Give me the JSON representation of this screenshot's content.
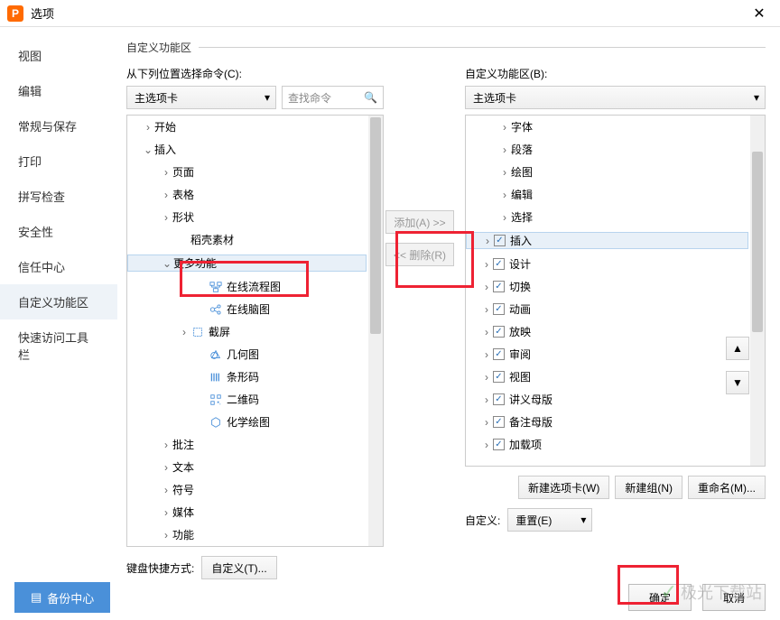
{
  "title": "选项",
  "sidebar": [
    "视图",
    "编辑",
    "常规与保存",
    "打印",
    "拼写检查",
    "安全性",
    "信任中心",
    "自定义功能区",
    "快速访问工具栏"
  ],
  "sidebar_active": 7,
  "section_title": "自定义功能区",
  "left": {
    "label": "从下列位置选择命令(C):",
    "select": "主选项卡",
    "search_placeholder": "查找命令",
    "tree": [
      {
        "d": 1,
        "exp": ">",
        "t": "开始"
      },
      {
        "d": 1,
        "exp": "v",
        "t": "插入"
      },
      {
        "d": 2,
        "exp": ">",
        "t": "页面"
      },
      {
        "d": 2,
        "exp": ">",
        "t": "表格"
      },
      {
        "d": 2,
        "exp": ">",
        "t": "形状"
      },
      {
        "d": 3,
        "exp": "",
        "t": "稻壳素材"
      },
      {
        "d": 2,
        "exp": "v",
        "t": "更多功能",
        "hi": true
      },
      {
        "d": 4,
        "exp": "",
        "icon": "flow",
        "t": "在线流程图"
      },
      {
        "d": 4,
        "exp": "",
        "icon": "mind",
        "t": "在线脑图"
      },
      {
        "d": 3,
        "exp": ">",
        "icon": "crop",
        "t": "截屏"
      },
      {
        "d": 4,
        "exp": "",
        "icon": "geo",
        "t": "几何图"
      },
      {
        "d": 4,
        "exp": "",
        "icon": "bar",
        "t": "条形码"
      },
      {
        "d": 4,
        "exp": "",
        "icon": "qr",
        "t": "二维码"
      },
      {
        "d": 4,
        "exp": "",
        "icon": "chem",
        "t": "化学绘图"
      },
      {
        "d": 2,
        "exp": ">",
        "t": "批注"
      },
      {
        "d": 2,
        "exp": ">",
        "t": "文本"
      },
      {
        "d": 2,
        "exp": ">",
        "t": "符号"
      },
      {
        "d": 2,
        "exp": ">",
        "t": "媒体"
      },
      {
        "d": 2,
        "exp": ">",
        "t": "功能"
      }
    ],
    "kbd_label": "键盘快捷方式:",
    "kbd_btn": "自定义(T)..."
  },
  "mid": {
    "add": "添加(A) >>",
    "remove": "<< 删除(R)"
  },
  "right": {
    "label": "自定义功能区(B):",
    "select": "主选项卡",
    "tree": [
      {
        "d": 2,
        "exp": ">",
        "t": "字体"
      },
      {
        "d": 2,
        "exp": ">",
        "t": "段落"
      },
      {
        "d": 2,
        "exp": ">",
        "t": "绘图"
      },
      {
        "d": 2,
        "exp": ">",
        "t": "编辑"
      },
      {
        "d": 2,
        "exp": ">",
        "t": "选择"
      },
      {
        "d": 1,
        "exp": ">",
        "chk": true,
        "t": "插入",
        "hi": true
      },
      {
        "d": 1,
        "exp": ">",
        "chk": true,
        "t": "设计"
      },
      {
        "d": 1,
        "exp": ">",
        "chk": true,
        "t": "切换"
      },
      {
        "d": 1,
        "exp": ">",
        "chk": true,
        "t": "动画"
      },
      {
        "d": 1,
        "exp": ">",
        "chk": true,
        "t": "放映"
      },
      {
        "d": 1,
        "exp": ">",
        "chk": true,
        "t": "审阅"
      },
      {
        "d": 1,
        "exp": ">",
        "chk": true,
        "t": "视图"
      },
      {
        "d": 1,
        "exp": ">",
        "chk": true,
        "t": "讲义母版"
      },
      {
        "d": 1,
        "exp": ">",
        "chk": true,
        "t": "备注母版"
      },
      {
        "d": 1,
        "exp": ">",
        "chk": true,
        "t": "加载项"
      }
    ],
    "btns": [
      "新建选项卡(W)",
      "新建组(N)",
      "重命名(M)..."
    ],
    "cust_label": "自定义:",
    "cust_btn": "重置(E)"
  },
  "footer": {
    "backup": "备份中心",
    "ok": "确定",
    "cancel": "取消"
  },
  "watermark": "极光下载站"
}
